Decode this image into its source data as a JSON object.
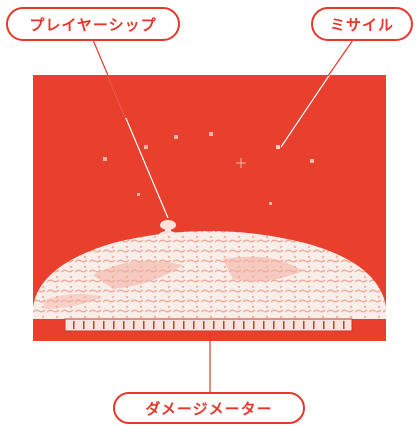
{
  "labels": {
    "player_ship": "プレイヤーシップ",
    "missile": "ミサイル",
    "damage_meter": "ダメージメーター"
  },
  "colors": {
    "screen_red": "#e8402c",
    "callout_red": "#e8372a",
    "earth_white": "#f8eeea",
    "earth_shade": "#f3b3a4"
  }
}
